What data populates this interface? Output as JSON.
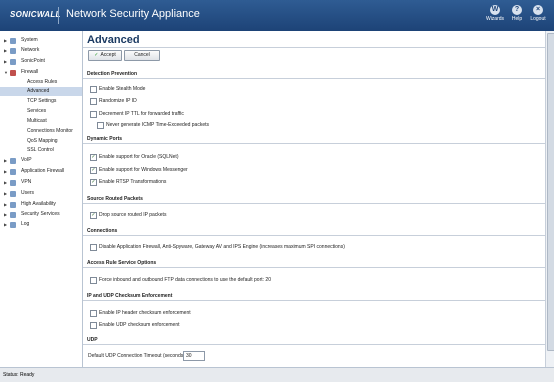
{
  "header": {
    "logo": "SONICWALL",
    "title": "Network Security Appliance",
    "buttons": [
      {
        "label": "Wizards",
        "icon": "W"
      },
      {
        "label": "Help",
        "icon": "?"
      },
      {
        "label": "Logout",
        "icon": "×"
      }
    ]
  },
  "sidebar": {
    "items": [
      {
        "label": "System"
      },
      {
        "label": "Network"
      },
      {
        "label": "SonicPoint"
      },
      {
        "label": "Firewall"
      }
    ],
    "firewall_sub": [
      {
        "label": "Access Rules"
      },
      {
        "label": "Advanced"
      },
      {
        "label": "TCP Settings"
      },
      {
        "label": "Services"
      },
      {
        "label": "Multicast"
      },
      {
        "label": "Connections Monitor"
      },
      {
        "label": "QoS Mapping"
      },
      {
        "label": "SSL Control"
      }
    ],
    "items2": [
      {
        "label": "VoIP"
      },
      {
        "label": "Application Firewall"
      },
      {
        "label": "VPN"
      },
      {
        "label": "Users"
      },
      {
        "label": "High Availability"
      },
      {
        "label": "Security Services"
      },
      {
        "label": "Log"
      }
    ]
  },
  "main": {
    "title": "Advanced",
    "accept_label": "Accept",
    "cancel_label": "Cancel",
    "sections": {
      "detection": {
        "title": "Detection Prevention",
        "opt1": "Enable Stealth Mode",
        "opt2": "Randomize IP ID",
        "opt3": "Decrement IP TTL for forwarded traffic",
        "opt4": "Never generate ICMP Time-Exceeded packets"
      },
      "dynamic": {
        "title": "Dynamic Ports",
        "opt1": "Enable support for Oracle (SQLNet)",
        "opt2": "Enable support for Windows Messenger",
        "opt3": "Enable RTSP Transformations"
      },
      "source": {
        "title": "Source Routed Packets",
        "opt1": "Drop source routed IP packets"
      },
      "connections": {
        "title": "Connections",
        "opt1": "Disable Application Firewall, Anti-Spyware, Gateway AV and IPS Engine (increases maximum SPI connections)"
      },
      "access": {
        "title": "Access Rule Service Options",
        "opt1": "Force inbound and outbound FTP data connections to use the default port: 20"
      },
      "checksum": {
        "title": "IP and UDP Checksum Enforcement",
        "opt1": "Enable IP header checksum enforcement",
        "opt2": "Enable UDP checksum enforcement"
      },
      "udp": {
        "title": "UDP",
        "timeout_label": "Default UDP Connection Timeout (seconds):",
        "timeout_value": "30"
      }
    },
    "checked_mark": "✓"
  },
  "status": {
    "text": "Status: Ready"
  }
}
